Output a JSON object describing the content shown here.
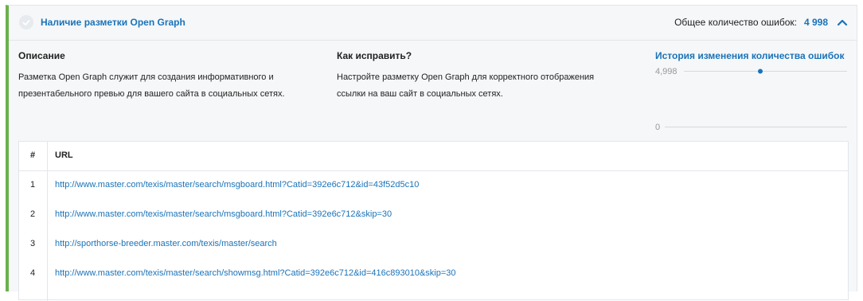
{
  "header": {
    "title": "Наличие разметки Open Graph",
    "errors_label": "Общее количество ошибок:",
    "errors_count": "4 998",
    "collapse_icon": "chevron-up-icon",
    "status_icon": "check-circle-icon"
  },
  "description": {
    "title": "Описание",
    "text_lines": [
      "Разметка Open Graph служит для создания информативного и",
      "презентабельного превью для вашего сайта в социальных сетях."
    ]
  },
  "fix": {
    "title": "Как исправить?",
    "text_lines": [
      "Настройте разметку Open Graph для корректного отображения",
      "ссылки на ваш сайт в социальных сетях."
    ]
  },
  "history": {
    "title": "История изменения количества ошибок",
    "tick_max": "4,998",
    "tick_min": "0"
  },
  "chart_data": {
    "type": "scatter",
    "title": "История изменения количества ошибок",
    "y_ticks": [
      "4,998",
      "0"
    ],
    "ylim": [
      0,
      4998
    ],
    "series": [
      {
        "values": [
          4998
        ]
      }
    ]
  },
  "table": {
    "col_num": "#",
    "col_url": "URL",
    "rows": [
      {
        "num": "1",
        "url": "http://www.master.com/texis/master/search/msgboard.html?Catid=392e6c712&id=43f52d5c10"
      },
      {
        "num": "2",
        "url": "http://www.master.com/texis/master/search/msgboard.html?Catid=392e6c712&skip=30"
      },
      {
        "num": "3",
        "url": "http://sporthorse-breeder.master.com/texis/master/search"
      },
      {
        "num": "4",
        "url": "http://www.master.com/texis/master/search/showmsg.html?Catid=392e6c712&id=416c893010&skip=30"
      }
    ]
  },
  "colors": {
    "accent": "#1a73b8",
    "status_bar": "#6ab04c",
    "panel_bg": "#f5f7f9"
  }
}
